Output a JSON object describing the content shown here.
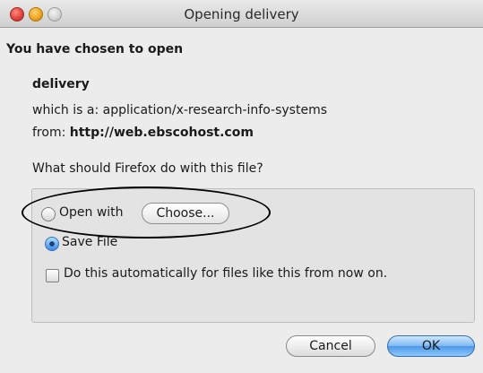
{
  "window": {
    "title": "Opening delivery"
  },
  "dialog": {
    "heading": "You have chosen to open",
    "filename": "delivery",
    "type_prefix": "which is a: ",
    "type_value": "application/x-research-info-systems",
    "from_prefix": "from: ",
    "from_host": "http://web.ebscohost.com",
    "question": "What should Firefox do with this file?"
  },
  "options": {
    "open_with_label": "Open with",
    "choose_label": "Choose...",
    "save_file_label": "Save File",
    "selected": "save_file",
    "auto_label": "Do this automatically for files like this from now on.",
    "auto_checked": false
  },
  "buttons": {
    "cancel": "Cancel",
    "ok": "OK"
  },
  "colors": {
    "accent": "#4f98e6",
    "background": "#ececec"
  }
}
